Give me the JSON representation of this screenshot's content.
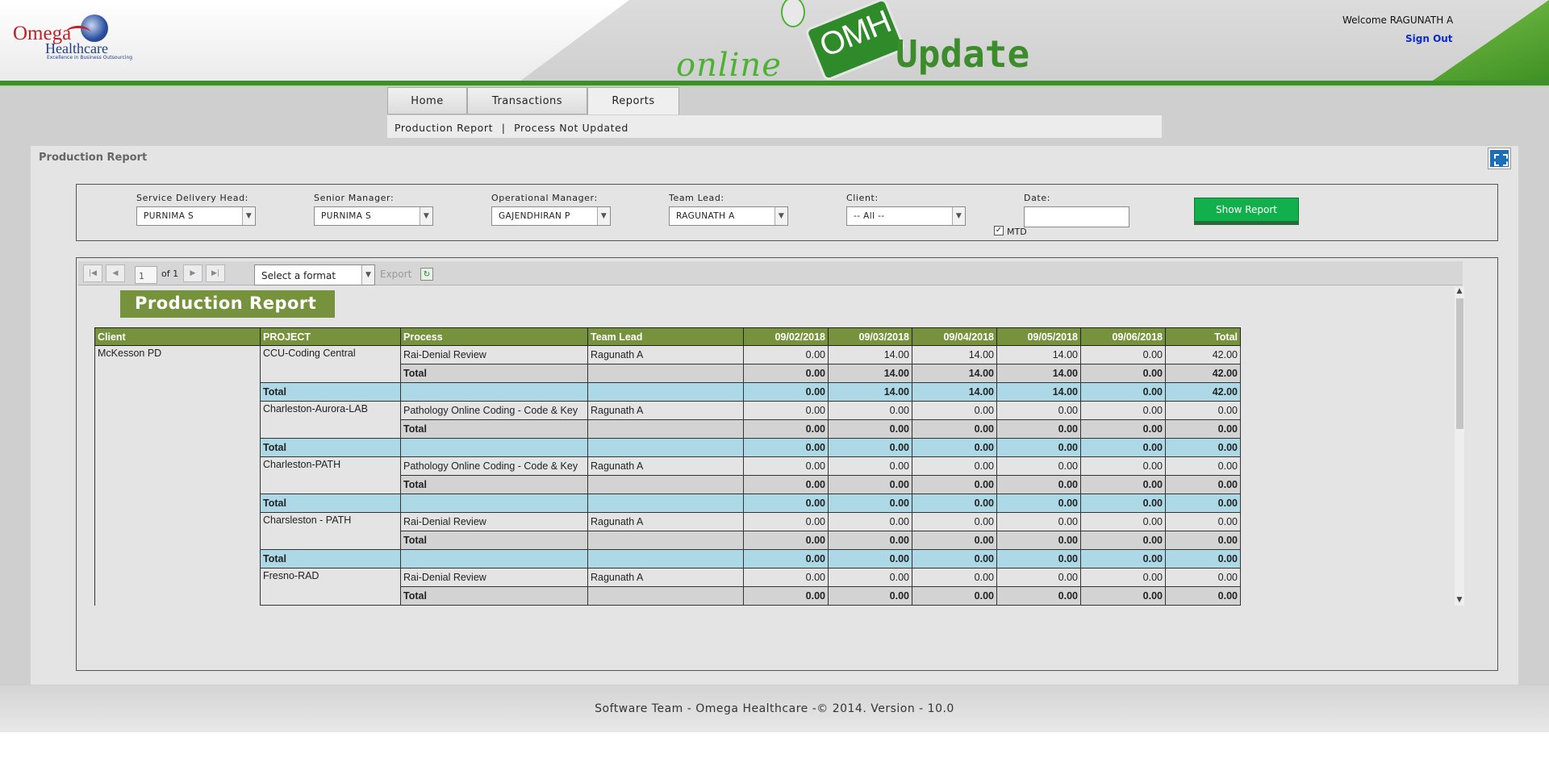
{
  "header": {
    "logo": {
      "name": "Omega",
      "sub": "Healthcare",
      "tagline": "Excellence in Business Outsourcing"
    },
    "brand": {
      "online": "online",
      "omh": "OMH",
      "update": "Update"
    },
    "welcome": "Welcome RAGUNATH A",
    "sign_out": "Sign Out"
  },
  "nav": {
    "tabs": [
      "Home",
      "Transactions",
      "Reports"
    ],
    "active_tab": "Reports",
    "subnav": {
      "item1": "Production Report",
      "sep": "|",
      "item2": "Process Not Updated"
    }
  },
  "panel": {
    "title": "Production Report",
    "filters": {
      "service_delivery_head": {
        "label": "Service Delivery Head:",
        "value": "PURNIMA S"
      },
      "senior_manager": {
        "label": "Senior Manager:",
        "value": "PURNIMA S"
      },
      "operational_manager": {
        "label": "Operational Manager:",
        "value": "GAJENDHIRAN P"
      },
      "team_lead": {
        "label": "Team Lead:",
        "value": "RAGUNATH A"
      },
      "client": {
        "label": "Client:",
        "value": "-- All --"
      },
      "date": {
        "label": "Date:",
        "value": ""
      },
      "mtd": {
        "label": "MTD",
        "checked": true
      },
      "show_report": "Show Report"
    }
  },
  "viewer": {
    "page_current": "1",
    "page_of": "of 1",
    "format_select": "Select a format",
    "export": "Export",
    "report_title": "Production Report",
    "columns": [
      "Client",
      "PROJECT",
      "Process",
      "Team Lead",
      "09/02/2018",
      "09/03/2018",
      "09/04/2018",
      "09/05/2018",
      "09/06/2018",
      "Total"
    ],
    "client": "McKesson PD",
    "total_label": "Total",
    "projects": [
      {
        "project": "CCU-Coding Central",
        "process": "Rai-Denial Review",
        "team_lead": "Ragunath A",
        "values": [
          "0.00",
          "14.00",
          "14.00",
          "14.00",
          "0.00",
          "42.00"
        ],
        "subtotal": [
          "0.00",
          "14.00",
          "14.00",
          "14.00",
          "0.00",
          "42.00"
        ],
        "total": [
          "0.00",
          "14.00",
          "14.00",
          "14.00",
          "0.00",
          "42.00"
        ]
      },
      {
        "project": "Charleston-Aurora-LAB",
        "process": "Pathology Online Coding - Code & Key",
        "team_lead": "Ragunath A",
        "values": [
          "0.00",
          "0.00",
          "0.00",
          "0.00",
          "0.00",
          "0.00"
        ],
        "subtotal": [
          "0.00",
          "0.00",
          "0.00",
          "0.00",
          "0.00",
          "0.00"
        ],
        "total": [
          "0.00",
          "0.00",
          "0.00",
          "0.00",
          "0.00",
          "0.00"
        ]
      },
      {
        "project": "Charleston-PATH",
        "process": "Pathology Online Coding - Code & Key",
        "team_lead": "Ragunath A",
        "values": [
          "0.00",
          "0.00",
          "0.00",
          "0.00",
          "0.00",
          "0.00"
        ],
        "subtotal": [
          "0.00",
          "0.00",
          "0.00",
          "0.00",
          "0.00",
          "0.00"
        ],
        "total": [
          "0.00",
          "0.00",
          "0.00",
          "0.00",
          "0.00",
          "0.00"
        ]
      },
      {
        "project": "Charsleston - PATH",
        "process": "Rai-Denial Review",
        "team_lead": "Ragunath A",
        "values": [
          "0.00",
          "0.00",
          "0.00",
          "0.00",
          "0.00",
          "0.00"
        ],
        "subtotal": [
          "0.00",
          "0.00",
          "0.00",
          "0.00",
          "0.00",
          "0.00"
        ],
        "total": [
          "0.00",
          "0.00",
          "0.00",
          "0.00",
          "0.00",
          "0.00"
        ]
      },
      {
        "project": "Fresno-RAD",
        "process": "Rai-Denial Review",
        "team_lead": "Ragunath A",
        "values": [
          "0.00",
          "0.00",
          "0.00",
          "0.00",
          "0.00",
          "0.00"
        ],
        "subtotal": [
          "0.00",
          "0.00",
          "0.00",
          "0.00",
          "0.00",
          "0.00"
        ]
      }
    ]
  },
  "footer": "Software Team - Omega Healthcare -© 2014. Version - 10.0"
}
